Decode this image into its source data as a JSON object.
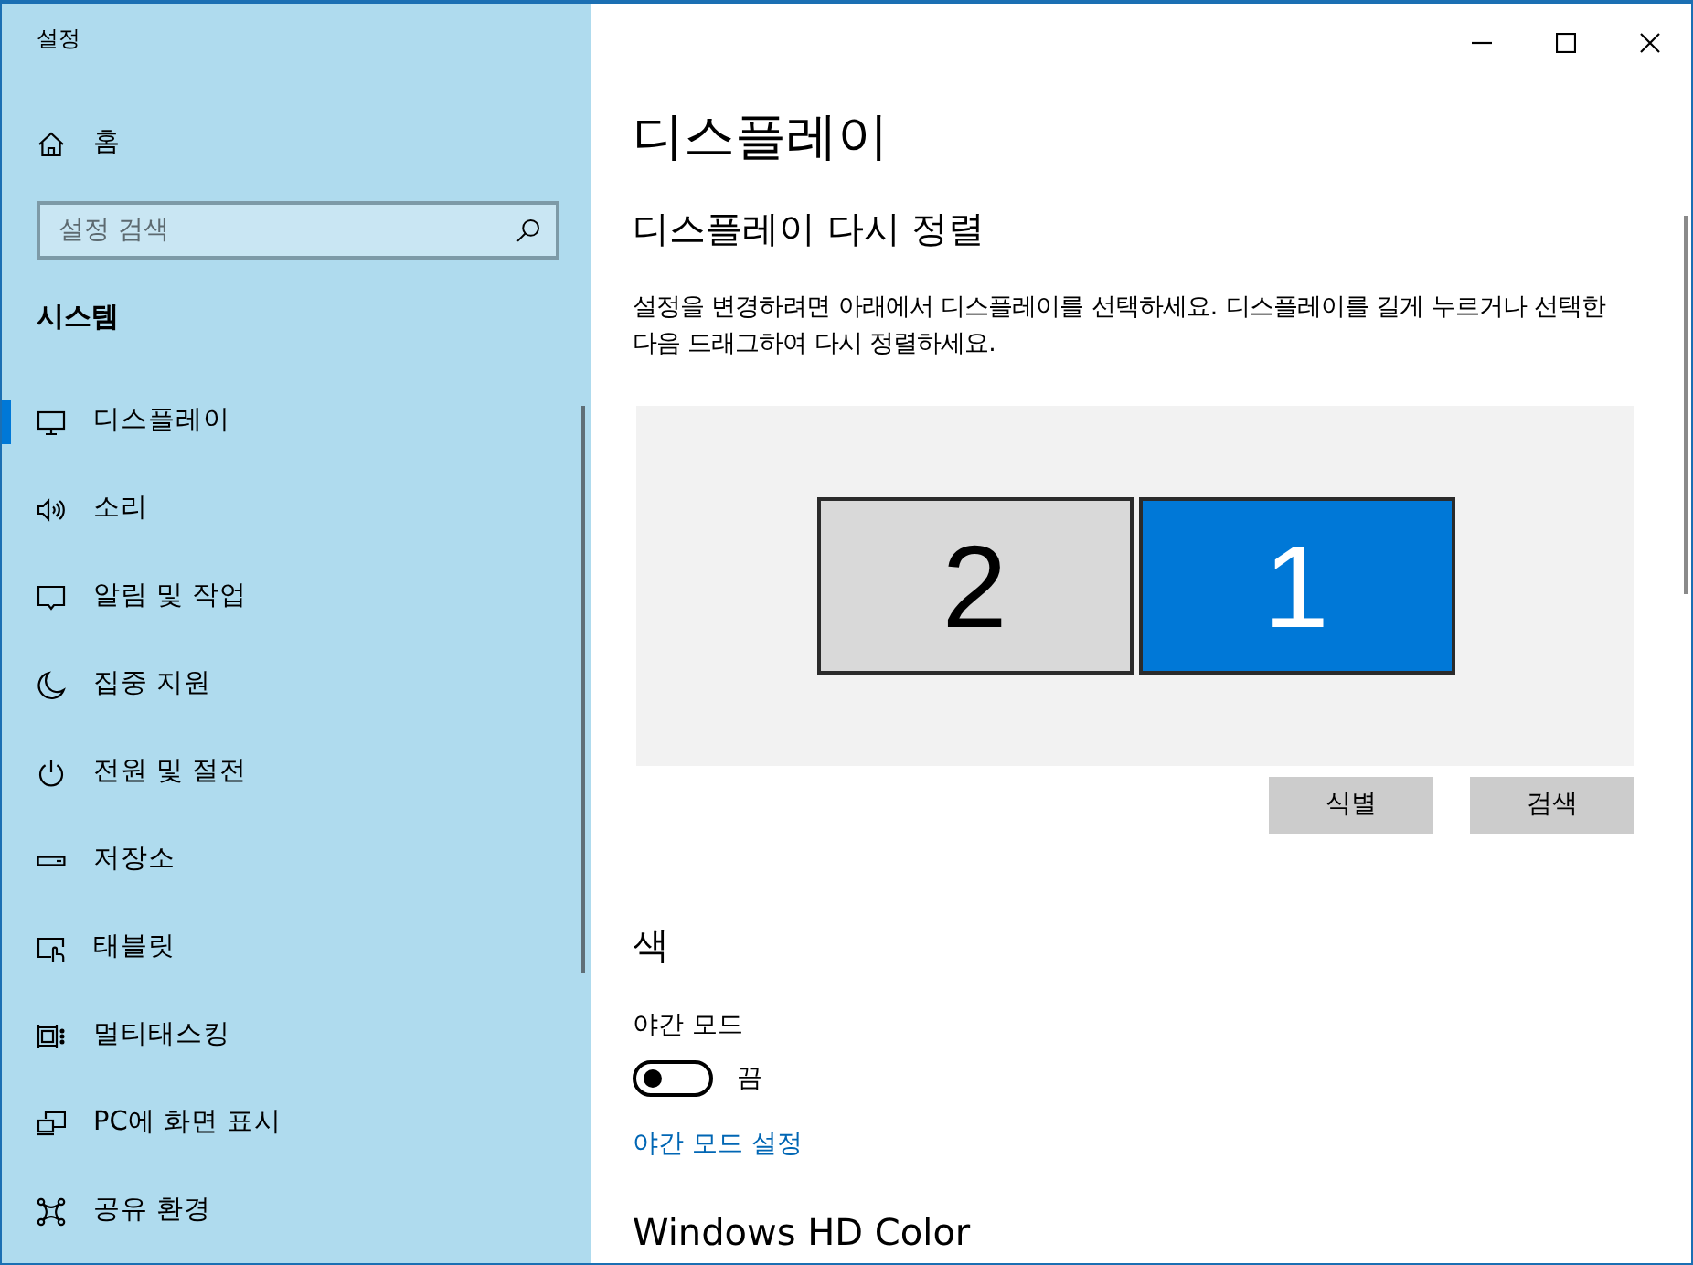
{
  "window": {
    "title": "설정"
  },
  "sidebar": {
    "home": {
      "label": "홈"
    },
    "search": {
      "placeholder": "설정 검색"
    },
    "section_title": "시스템",
    "items": [
      {
        "label": "디스플레이",
        "selected": true
      },
      {
        "label": "소리",
        "selected": false
      },
      {
        "label": "알림 및 작업",
        "selected": false
      },
      {
        "label": "집중 지원",
        "selected": false
      },
      {
        "label": "전원 및 절전",
        "selected": false
      },
      {
        "label": "저장소",
        "selected": false
      },
      {
        "label": "태블릿",
        "selected": false
      },
      {
        "label": "멀티태스킹",
        "selected": false
      },
      {
        "label": "PC에 화면 표시",
        "selected": false
      },
      {
        "label": "공유 환경",
        "selected": false
      }
    ]
  },
  "page": {
    "title": "디스플레이",
    "subtitle": "디스플레이 다시 정렬",
    "description": "설정을 변경하려면 아래에서 디스플레이를 선택하세요. 디스플레이를 길게 누르거나 선택한 다음 드래그하여 다시 정렬하세요.",
    "displays": [
      {
        "label": "2",
        "selected": false
      },
      {
        "label": "1",
        "selected": true
      }
    ],
    "buttons": [
      "식별",
      "검색"
    ],
    "color_section": {
      "title": "색",
      "night_light": {
        "label": "야간 모드",
        "on": false,
        "state_text": "끔"
      },
      "link": "야간 모드 설정"
    },
    "next_section_title": "Windows HD Color"
  }
}
